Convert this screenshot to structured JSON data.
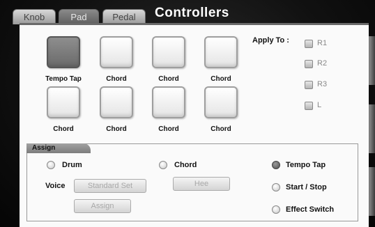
{
  "tabs": [
    {
      "label": "Knob",
      "active": false
    },
    {
      "label": "Pad",
      "active": true
    },
    {
      "label": "Pedal",
      "active": false
    }
  ],
  "title": "Controllers",
  "pads": [
    {
      "label": "Tempo Tap",
      "active": true
    },
    {
      "label": "Chord",
      "active": false
    },
    {
      "label": "Chord",
      "active": false
    },
    {
      "label": "Chord",
      "active": false
    },
    {
      "label": "Chord",
      "active": false
    },
    {
      "label": "Chord",
      "active": false
    },
    {
      "label": "Chord",
      "active": false
    },
    {
      "label": "Chord",
      "active": false
    }
  ],
  "apply_to": {
    "label": "Apply To :",
    "options": [
      {
        "label": "R1",
        "checked": false
      },
      {
        "label": "R2",
        "checked": false
      },
      {
        "label": "R3",
        "checked": false
      },
      {
        "label": "L",
        "checked": false
      }
    ]
  },
  "assign": {
    "header": "Assign",
    "drum_label": "Drum",
    "chord_label": "Chord",
    "voice_label": "Voice",
    "voice_value": "Standard Set",
    "chord_value": "Hee",
    "assign_button": "Assign",
    "functions": [
      {
        "label": "Tempo Tap",
        "selected": true
      },
      {
        "label": "Start / Stop",
        "selected": false
      },
      {
        "label": "Effect Switch",
        "selected": false
      }
    ]
  }
}
